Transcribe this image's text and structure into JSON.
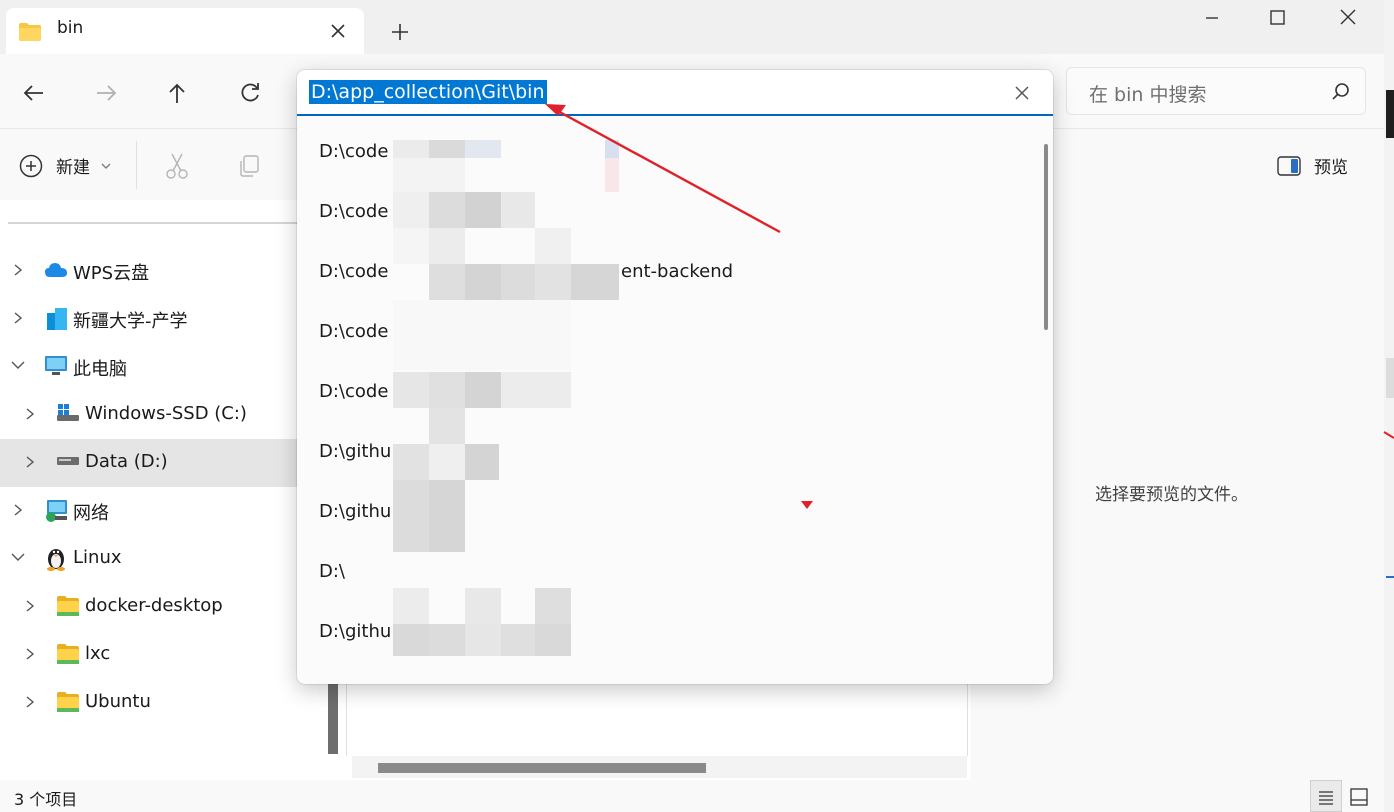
{
  "window": {
    "tab_title": "bin",
    "new_tab_symbol": "+"
  },
  "nav": {
    "address_value": "D:\\app_collection\\Git\\bin",
    "search_placeholder": "在 bin 中搜索"
  },
  "address_suggestions": [
    "D:\\code",
    "D:\\code",
    "D:\\code",
    "D:\\code",
    "D:\\code",
    "D:\\githu",
    "D:\\githu",
    "D:\\",
    "D:\\githu"
  ],
  "address_suggestion_tail": "ent-backend",
  "toolbar": {
    "new_label": "新建",
    "preview_label": "预览"
  },
  "sidebar": {
    "items": [
      {
        "label": "WPS云盘",
        "icon": "cloud-icon"
      },
      {
        "label": "新疆大学-产学",
        "icon": "building-icon"
      },
      {
        "label": "此电脑",
        "icon": "monitor-icon"
      },
      {
        "label": "Windows-SSD (C:)",
        "icon": "windows-drive-icon"
      },
      {
        "label": "Data (D:)",
        "icon": "drive-icon"
      },
      {
        "label": "网络",
        "icon": "network-icon"
      },
      {
        "label": "Linux",
        "icon": "penguin-icon"
      },
      {
        "label": "docker-desktop",
        "icon": "folder-icon"
      },
      {
        "label": "lxc",
        "icon": "folder-icon"
      },
      {
        "label": "Ubuntu",
        "icon": "folder-icon"
      }
    ]
  },
  "preview_pane": {
    "message": "选择要预览的文件。"
  },
  "status": {
    "item_count": "3 个项目"
  },
  "colors": {
    "accent": "#0078d4",
    "annotation_arrow": "#e0202a",
    "folder": "#f6c744"
  }
}
